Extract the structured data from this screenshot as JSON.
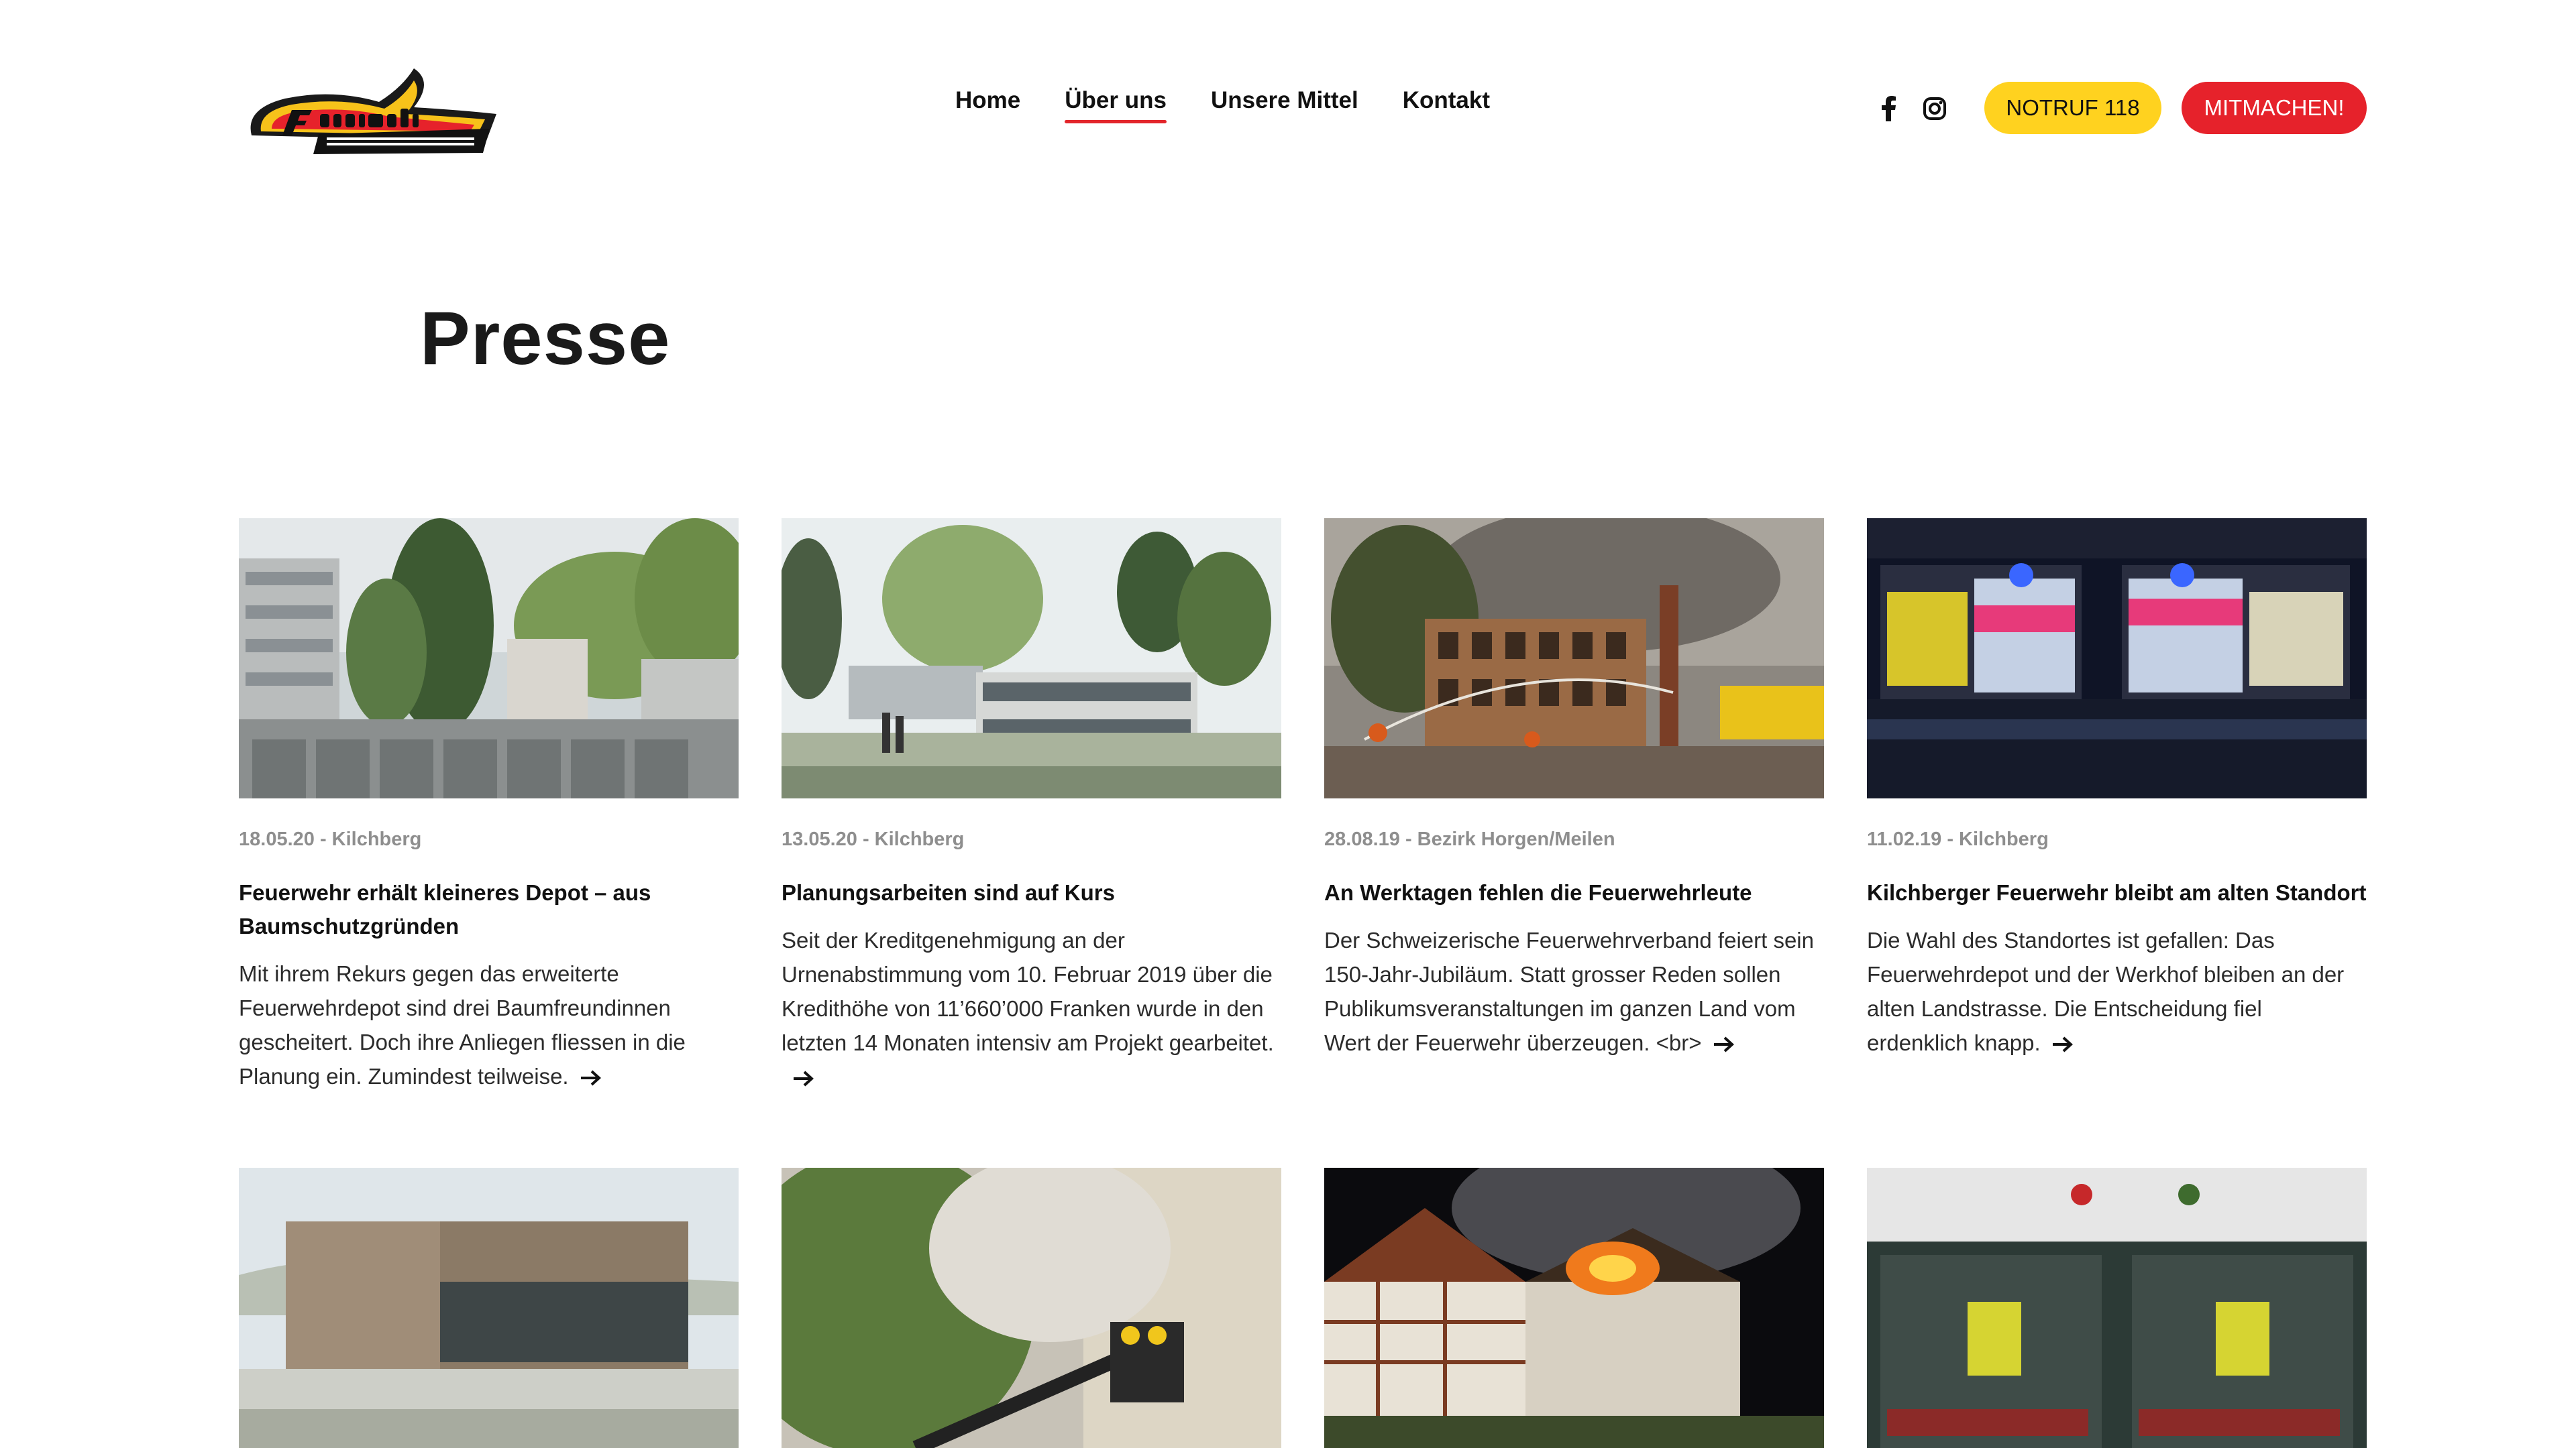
{
  "header": {
    "logo_alt": "Feuerwehr Kilchberg-Rüschlikon",
    "nav": [
      {
        "label": "Home",
        "active": false
      },
      {
        "label": "Über uns",
        "active": true
      },
      {
        "label": "Unsere Mittel",
        "active": false
      },
      {
        "label": "Kontakt",
        "active": false
      }
    ],
    "social": {
      "facebook_icon": "facebook-icon",
      "instagram_icon": "instagram-icon"
    },
    "notruf_label": "NOTRUF 118",
    "mitmachen_label": "MITMACHEN!"
  },
  "page": {
    "title": "Presse"
  },
  "articles": [
    {
      "meta": "18.05.20 - Kilchberg",
      "title": "Feuerwehr erhält kleineres Depot – aus Baumschutzgründen",
      "excerpt": "Mit ihrem Rekurs gegen das erweiterte Feuerwehrdepot sind drei Baumfreundinnen gescheitert. Doch ihre Anliegen fliessen in die Planung ein. Zumindest teilweise."
    },
    {
      "meta": "13.05.20 - Kilchberg",
      "title": "Planungsarbeiten sind auf Kurs",
      "excerpt": "Seit der Kreditgenehmigung an der Urnenabstimmung vom 10. Februar 2019 über die Kredithöhe von 11’660’000 Franken wurde in den letzten 14 Monaten intensiv am Projekt gearbeitet."
    },
    {
      "meta": "28.08.19 - Bezirk Horgen/Meilen",
      "title": "An Werktagen fehlen die Feuerwehrleute",
      "excerpt": "Der Schweizerische Feuerwehrverband feiert sein 150-Jahr-Jubiläum. Statt grosser Reden sollen Publikumsveranstaltungen im ganzen Land vom Wert der Feuerwehr überzeugen. <br>"
    },
    {
      "meta": "11.02.19 - Kilchberg",
      "title": "Kilchberger Feuerwehr bleibt am alten Standort",
      "excerpt": "Die Wahl des Standortes ist gefallen: Das Feuerwehrdepot und der Werkhof bleiben an der alten Landstrasse. Die Entscheidung fiel erdenklich knapp."
    }
  ],
  "colors": {
    "accent_red": "#e6222b",
    "accent_yellow": "#ffd21f",
    "meta_gray": "#8e8e8e"
  }
}
